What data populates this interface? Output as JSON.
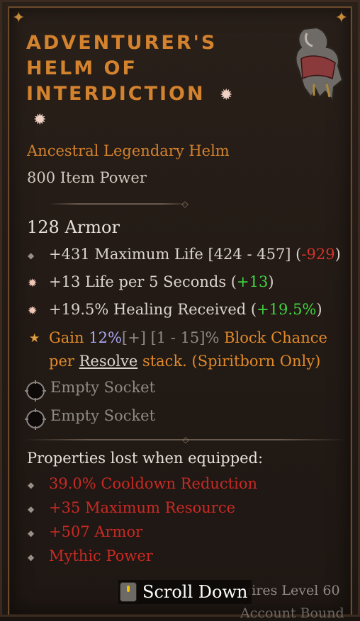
{
  "item": {
    "title_lines": [
      "ADVENTURER'S",
      "HELM OF",
      "INTERDICTION"
    ],
    "subtype": "Ancestral Legendary Helm",
    "item_power": "800 Item Power",
    "armor": "128 Armor"
  },
  "affixes": [
    {
      "prefix": "+431 Maximum Life [424 - 457] (",
      "diff": "-929",
      "suffix": ")",
      "diff_color": "#d3332a",
      "bullet": "diamond"
    },
    {
      "prefix": "+13 Life per 5 Seconds (",
      "diff": "+13",
      "suffix": ")",
      "diff_color": "#3fd43f",
      "bullet": "star"
    },
    {
      "prefix": "+19.5% Healing Received (",
      "diff": "+19.5%",
      "suffix": ")",
      "diff_color": "#3fd43f",
      "bullet": "star"
    }
  ],
  "legendary": {
    "part1": "Gain ",
    "value": "12%",
    "plus": "[+]",
    "range": " [1 - 15]% ",
    "part2": "Block Chance",
    "part3": "per ",
    "keyword": "Resolve",
    "part4": " stack. (Spiritborn Only)"
  },
  "sockets": [
    {
      "label": "Empty Socket"
    },
    {
      "label": "Empty Socket"
    }
  ],
  "lost": {
    "title": "Properties lost when equipped:",
    "items": [
      "39.0% Cooldown Reduction",
      "+35 Maximum Resource",
      "+507 Armor",
      "Mythic Power"
    ]
  },
  "footer": {
    "requires": "uires Level 60",
    "bound": "Account Bound"
  },
  "scroll_hint": {
    "label": "Scroll Down",
    "icon": "mouse-scroll-icon"
  },
  "colors": {
    "title": "#d3822d",
    "legendary_text": "#e08a2a",
    "negative": "#d3332a",
    "positive": "#3fd43f",
    "lost": "#c82a24"
  }
}
